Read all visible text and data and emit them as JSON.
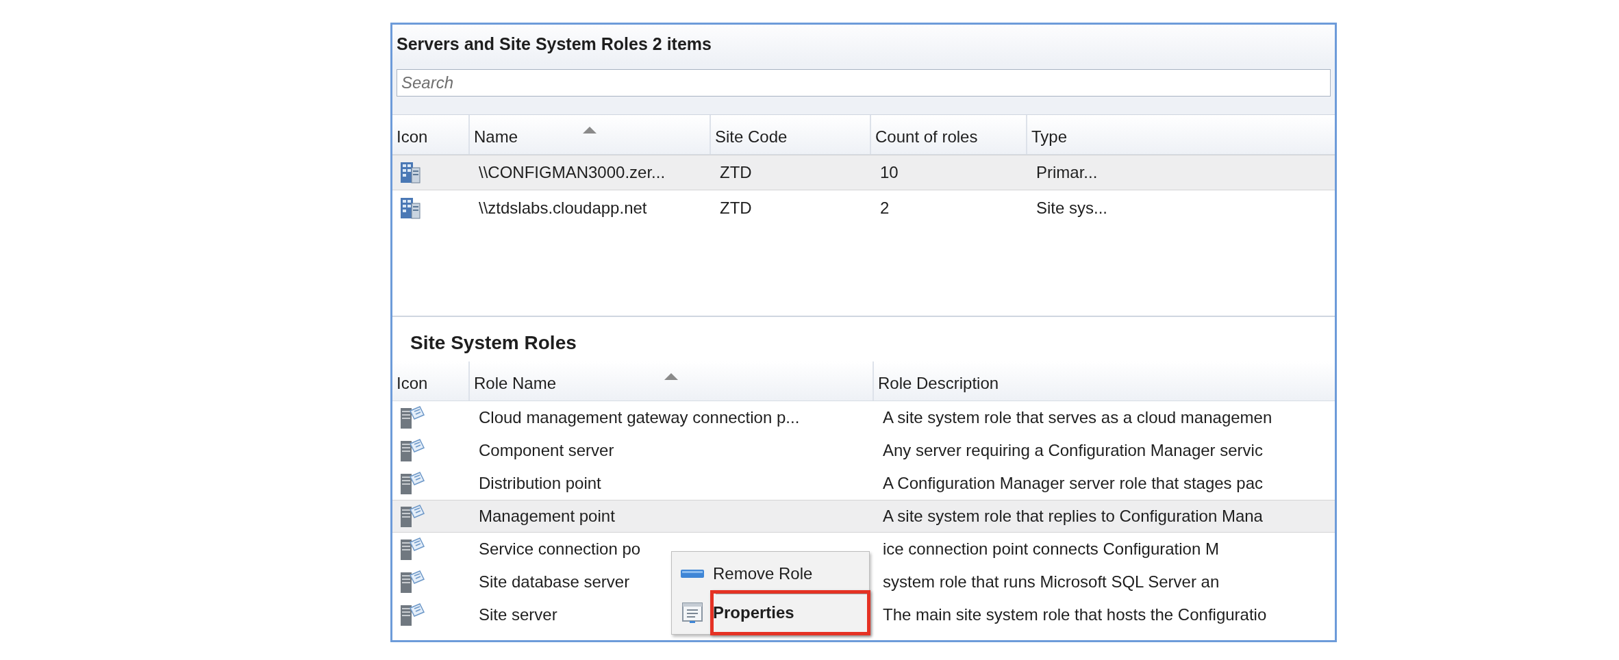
{
  "header": {
    "title": "Servers and Site System Roles 2 items"
  },
  "search": {
    "placeholder": "Search"
  },
  "servers_table": {
    "columns": [
      {
        "label": "Icon",
        "sorted": false
      },
      {
        "label": "Name",
        "sorted": true
      },
      {
        "label": "Site Code",
        "sorted": false
      },
      {
        "label": "Count of roles",
        "sorted": false
      },
      {
        "label": "Type",
        "sorted": false
      }
    ],
    "rows": [
      {
        "selected": true,
        "cells": [
          "",
          "\\\\CONFIGMAN3000.zer...",
          "ZTD",
          "10",
          "Primar..."
        ]
      },
      {
        "selected": false,
        "cells": [
          "",
          "\\\\ztdslabs.cloudapp.net",
          "ZTD",
          "2",
          "Site sys..."
        ]
      }
    ]
  },
  "roles_section": {
    "title": "Site System Roles",
    "columns": [
      {
        "label": "Icon",
        "sorted": false
      },
      {
        "label": "Role Name",
        "sorted": true
      },
      {
        "label": "Role Description",
        "sorted": false
      }
    ],
    "rows": [
      {
        "selected": false,
        "cells": [
          "",
          "Cloud management gateway connection p...",
          "A site system role that serves as a cloud managemen"
        ]
      },
      {
        "selected": false,
        "cells": [
          "",
          "Component server",
          "Any server requiring a Configuration Manager servic"
        ]
      },
      {
        "selected": false,
        "cells": [
          "",
          "Distribution point",
          "A Configuration Manager server role that stages pac"
        ]
      },
      {
        "selected": true,
        "cells": [
          "",
          "Management point",
          "A site system role that replies to Configuration Mana"
        ]
      },
      {
        "selected": false,
        "cells": [
          "",
          "Service connection po",
          "ice connection point connects Configuration M"
        ]
      },
      {
        "selected": false,
        "cells": [
          "",
          "Site database server",
          "system role that runs Microsoft SQL Server an"
        ]
      },
      {
        "selected": false,
        "cells": [
          "",
          "Site server",
          "The main site system role that hosts the Configuratio"
        ]
      }
    ]
  },
  "context_menu": {
    "items": [
      {
        "kind": "remove",
        "label": "Remove Role",
        "bold": false,
        "highlighted": false
      },
      {
        "kind": "properties",
        "label": "Properties",
        "bold": true,
        "highlighted": true
      }
    ]
  }
}
